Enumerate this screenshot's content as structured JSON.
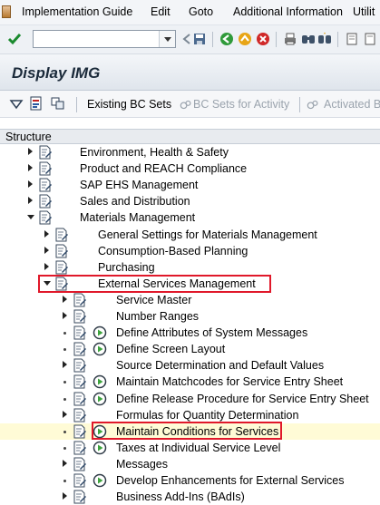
{
  "menu": {
    "items": [
      "Implementation Guide",
      "Edit",
      "Goto",
      "Additional Information",
      "Utilit"
    ]
  },
  "toolbar": {
    "command_value": ""
  },
  "title": "Display IMG",
  "app_toolbar": {
    "existing": "Existing BC Sets",
    "for_activity": "BC Sets for Activity",
    "activated": "Activated B"
  },
  "structure": {
    "header": "Structure",
    "rows": [
      {
        "label": "Environment, Health & Safety",
        "level": 0,
        "state": "closed",
        "exec": false
      },
      {
        "label": "Product and REACH Compliance",
        "level": 0,
        "state": "closed",
        "exec": false
      },
      {
        "label": "SAP EHS Management",
        "level": 0,
        "state": "closed",
        "exec": false
      },
      {
        "label": "Sales and Distribution",
        "level": 0,
        "state": "closed",
        "exec": false
      },
      {
        "label": "Materials Management",
        "level": 0,
        "state": "open",
        "exec": false
      },
      {
        "label": "General Settings for Materials Management",
        "level": 1,
        "state": "closed",
        "exec": false
      },
      {
        "label": "Consumption-Based Planning",
        "level": 1,
        "state": "closed",
        "exec": false
      },
      {
        "label": "Purchasing",
        "level": 1,
        "state": "closed",
        "exec": false
      },
      {
        "label": "External Services Management",
        "level": 1,
        "state": "open",
        "exec": false
      },
      {
        "label": "Service Master",
        "level": 2,
        "state": "closed",
        "exec": false
      },
      {
        "label": "Number Ranges",
        "level": 2,
        "state": "closed",
        "exec": false
      },
      {
        "label": "Define Attributes of System Messages",
        "level": 2,
        "state": "leaf",
        "exec": true
      },
      {
        "label": "Define Screen Layout",
        "level": 2,
        "state": "leaf",
        "exec": true
      },
      {
        "label": "Source Determination and Default Values",
        "level": 2,
        "state": "closed",
        "exec": false
      },
      {
        "label": "Maintain Matchcodes for Service Entry Sheet",
        "level": 2,
        "state": "leaf",
        "exec": true
      },
      {
        "label": "Define Release Procedure for Service Entry Sheet",
        "level": 2,
        "state": "leaf",
        "exec": true
      },
      {
        "label": "Formulas for Quantity Determination",
        "level": 2,
        "state": "closed",
        "exec": false
      },
      {
        "label": "Maintain Conditions for Services",
        "level": 2,
        "state": "leaf",
        "exec": true
      },
      {
        "label": "Taxes at Individual Service Level",
        "level": 2,
        "state": "leaf",
        "exec": true
      },
      {
        "label": "Messages",
        "level": 2,
        "state": "closed",
        "exec": false
      },
      {
        "label": "Develop Enhancements for External Services",
        "level": 2,
        "state": "leaf",
        "exec": true
      },
      {
        "label": "Business Add-Ins (BAdIs)",
        "level": 2,
        "state": "closed",
        "exec": false
      }
    ]
  },
  "colors": {
    "highlight_border": "#e0182a",
    "highlight_fill": "#fffbd6"
  }
}
